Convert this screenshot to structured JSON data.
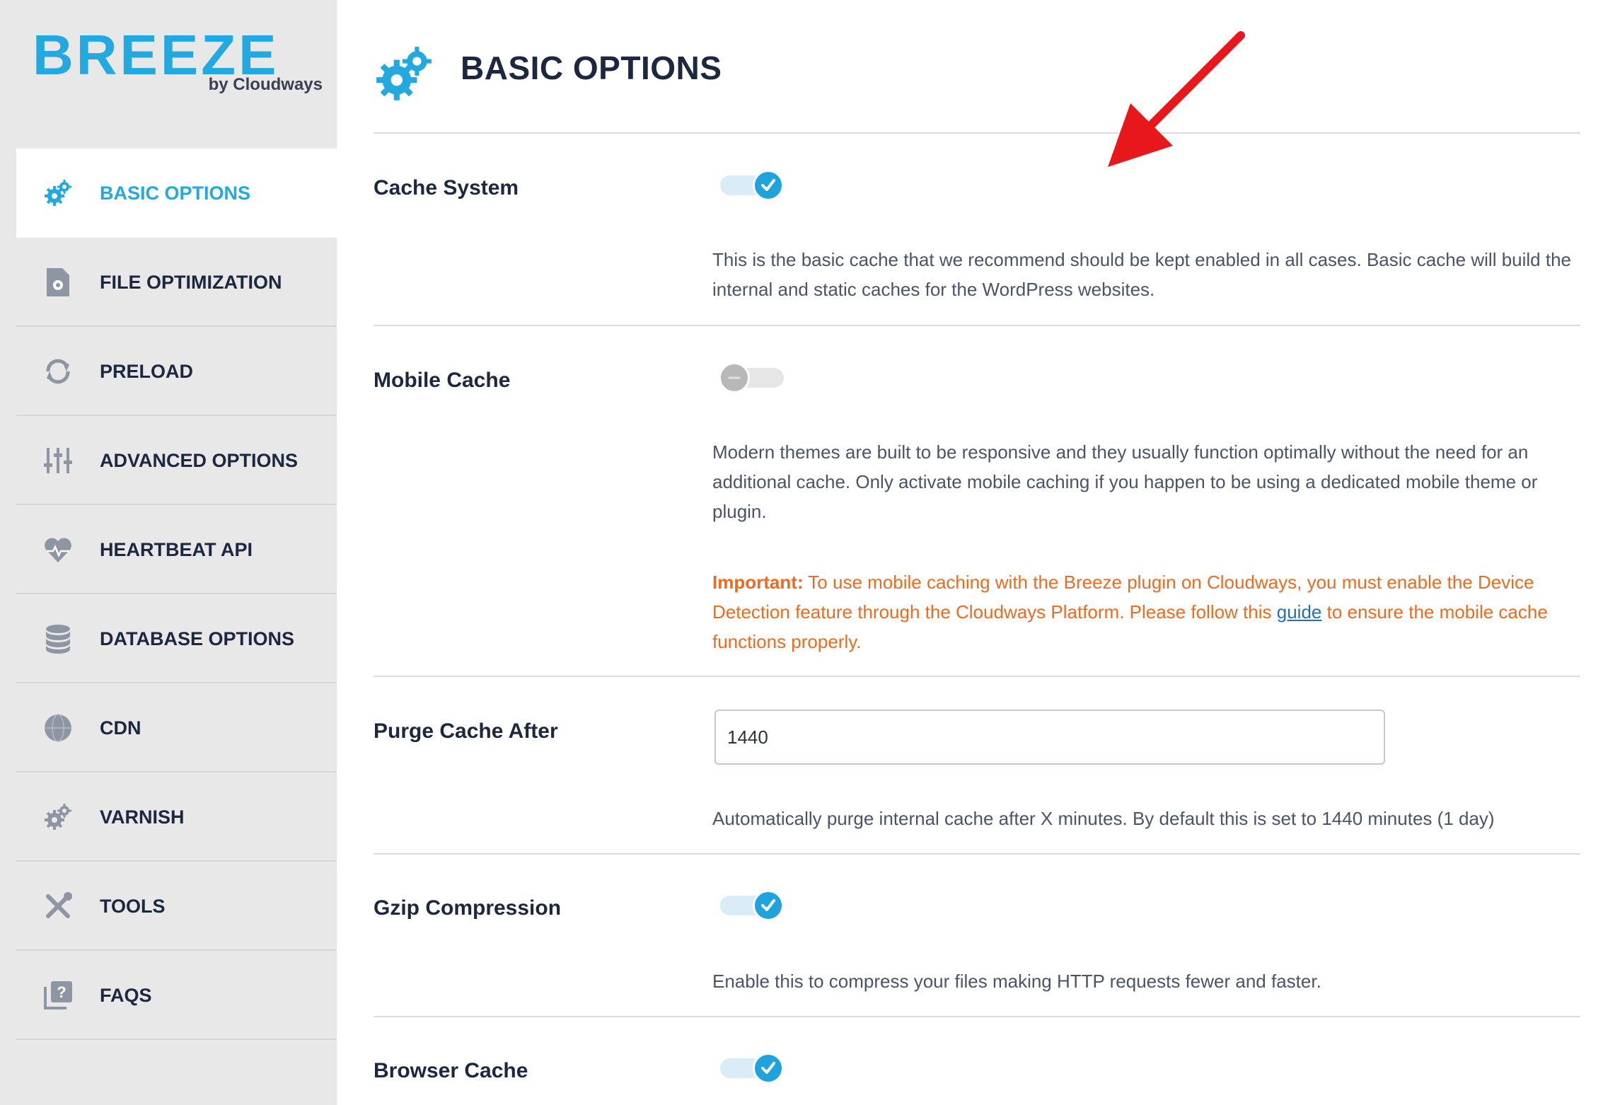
{
  "brand": {
    "logo_text": "BREEZE",
    "logo_subtitle": "by Cloudways",
    "accent_color": "#23a8e0"
  },
  "sidebar": {
    "items": [
      {
        "label": "BASIC OPTIONS",
        "icon": "gears-icon",
        "active": true
      },
      {
        "label": "FILE OPTIMIZATION",
        "icon": "file-gear-icon",
        "active": false
      },
      {
        "label": "PRELOAD",
        "icon": "refresh-icon",
        "active": false
      },
      {
        "label": "ADVANCED OPTIONS",
        "icon": "sliders-icon",
        "active": false
      },
      {
        "label": "HEARTBEAT API",
        "icon": "heartbeat-icon",
        "active": false
      },
      {
        "label": "DATABASE OPTIONS",
        "icon": "database-icon",
        "active": false
      },
      {
        "label": "CDN",
        "icon": "globe-icon",
        "active": false
      },
      {
        "label": "VARNISH",
        "icon": "gears-icon",
        "active": false
      },
      {
        "label": "TOOLS",
        "icon": "tools-icon",
        "active": false
      },
      {
        "label": "FAQS",
        "icon": "faq-icon",
        "active": false
      }
    ]
  },
  "main": {
    "title": "BASIC OPTIONS",
    "options": {
      "cache_system": {
        "label": "Cache System",
        "enabled": true,
        "description": "This is the basic cache that we recommend should be kept enabled in all cases. Basic cache will build the internal and static caches for the WordPress websites."
      },
      "mobile_cache": {
        "label": "Mobile Cache",
        "enabled": false,
        "description": "Modern themes are built to be responsive and they usually function optimally without the need for an additional cache. Only activate mobile caching if you happen to be using a dedicated mobile theme or plugin.",
        "important_label": "Important:",
        "important_text_1": " To use mobile caching with the Breeze plugin on Cloudways, you must enable the Device Detection feature through the Cloudways Platform. Please follow this ",
        "important_link": "guide",
        "important_text_2": " to ensure the mobile cache functions properly."
      },
      "purge_cache_after": {
        "label": "Purge Cache After",
        "value": "1440",
        "description": "Automatically purge internal cache after X minutes. By default this is set to 1440 minutes (1 day)"
      },
      "gzip_compression": {
        "label": "Gzip Compression",
        "enabled": true,
        "description": "Enable this to compress your files making HTTP requests fewer and faster."
      },
      "browser_cache": {
        "label": "Browser Cache",
        "enabled": true
      }
    }
  },
  "annotation": {
    "arrow_color": "#e8171b"
  }
}
